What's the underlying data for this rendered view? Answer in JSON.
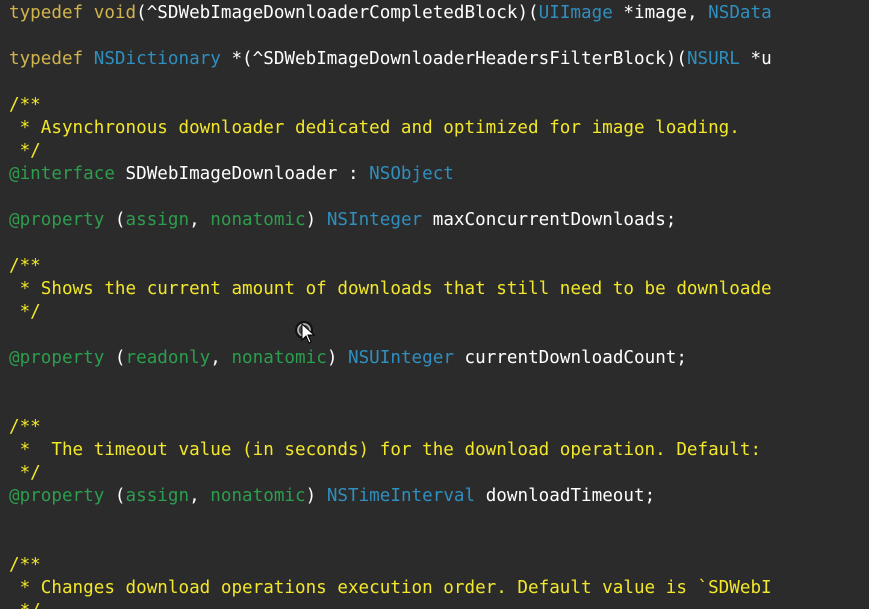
{
  "colors": {
    "background": "#2b2b2b",
    "keyword": "#d2b44d",
    "type": "#2f8fbf",
    "comment": "#f2e72a",
    "directive": "#2d9d4e",
    "attribute": "#2d9d4e",
    "plain": "#ffffff"
  },
  "code": {
    "lines": [
      [
        {
          "t": "typedef",
          "k": "keyword"
        },
        {
          "t": " ",
          "k": "plain"
        },
        {
          "t": "void",
          "k": "keyword"
        },
        {
          "t": "(^SDWebImageDownloaderCompletedBlock)(",
          "k": "plain"
        },
        {
          "t": "UIImage",
          "k": "type"
        },
        {
          "t": " *image, ",
          "k": "plain"
        },
        {
          "t": "NSData",
          "k": "type"
        }
      ],
      [],
      [
        {
          "t": "typedef",
          "k": "keyword"
        },
        {
          "t": " ",
          "k": "plain"
        },
        {
          "t": "NSDictionary",
          "k": "type"
        },
        {
          "t": " *(^SDWebImageDownloaderHeadersFilterBlock)(",
          "k": "plain"
        },
        {
          "t": "NSURL",
          "k": "type"
        },
        {
          "t": " *u",
          "k": "plain"
        }
      ],
      [],
      [
        {
          "t": "/**",
          "k": "comment"
        }
      ],
      [
        {
          "t": " * Asynchronous downloader dedicated and optimized for image loading.",
          "k": "comment"
        }
      ],
      [
        {
          "t": " */",
          "k": "comment"
        }
      ],
      [
        {
          "t": "@interface",
          "k": "directive"
        },
        {
          "t": " SDWebImageDownloader : ",
          "k": "plain"
        },
        {
          "t": "NSObject",
          "k": "type"
        }
      ],
      [],
      [
        {
          "t": "@property",
          "k": "directive"
        },
        {
          "t": " (",
          "k": "plain"
        },
        {
          "t": "assign",
          "k": "attribute"
        },
        {
          "t": ", ",
          "k": "plain"
        },
        {
          "t": "nonatomic",
          "k": "attribute"
        },
        {
          "t": ") ",
          "k": "plain"
        },
        {
          "t": "NSInteger",
          "k": "type"
        },
        {
          "t": " maxConcurrentDownloads;",
          "k": "plain"
        }
      ],
      [],
      [
        {
          "t": "/**",
          "k": "comment"
        }
      ],
      [
        {
          "t": " * Shows the current amount of downloads that still need to be downloade",
          "k": "comment"
        }
      ],
      [
        {
          "t": " */",
          "k": "comment"
        }
      ],
      [],
      [
        {
          "t": "@property",
          "k": "directive"
        },
        {
          "t": " (",
          "k": "plain"
        },
        {
          "t": "readonly",
          "k": "attribute"
        },
        {
          "t": ", ",
          "k": "plain"
        },
        {
          "t": "nonatomic",
          "k": "attribute"
        },
        {
          "t": ") ",
          "k": "plain"
        },
        {
          "t": "NSUInteger",
          "k": "type"
        },
        {
          "t": " currentDownloadCount;",
          "k": "plain"
        }
      ],
      [],
      [],
      [
        {
          "t": "/**",
          "k": "comment"
        }
      ],
      [
        {
          "t": " *  The timeout value (in seconds) for the download operation. Default:",
          "k": "comment"
        }
      ],
      [
        {
          "t": " */",
          "k": "comment"
        }
      ],
      [
        {
          "t": "@property",
          "k": "directive"
        },
        {
          "t": " (",
          "k": "plain"
        },
        {
          "t": "assign",
          "k": "attribute"
        },
        {
          "t": ", ",
          "k": "plain"
        },
        {
          "t": "nonatomic",
          "k": "attribute"
        },
        {
          "t": ") ",
          "k": "plain"
        },
        {
          "t": "NSTimeInterval",
          "k": "type"
        },
        {
          "t": " downloadTimeout;",
          "k": "plain"
        }
      ],
      [],
      [],
      [
        {
          "t": "/**",
          "k": "comment"
        }
      ],
      [
        {
          "t": " * Changes download operations execution order. Default value is `SDWebI",
          "k": "comment"
        }
      ],
      [
        {
          "t": " */",
          "k": "comment"
        }
      ]
    ]
  },
  "cursor": {
    "icon": "busy-pointer-icon"
  }
}
